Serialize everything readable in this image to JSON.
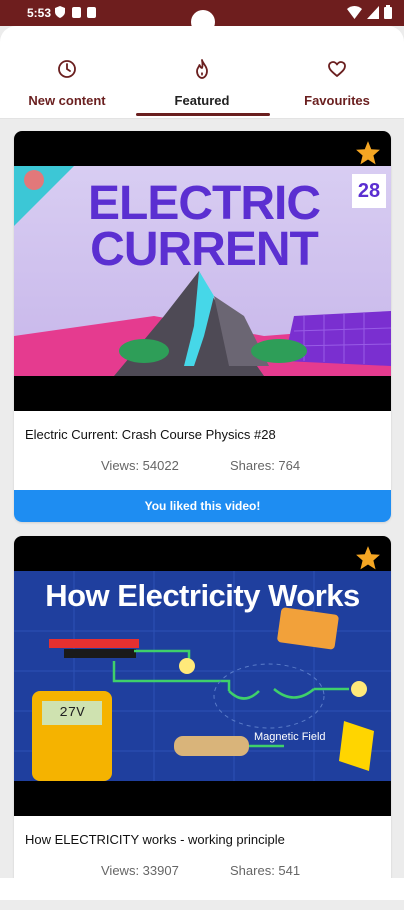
{
  "status_bar": {
    "time": "5:53"
  },
  "tabs": [
    {
      "label": "New content",
      "icon": "clock-icon"
    },
    {
      "label": "Featured",
      "icon": "fire-icon",
      "active": true
    },
    {
      "label": "Favourites",
      "icon": "heart-icon"
    }
  ],
  "videos": [
    {
      "thumbnail_text": "ELECTRIC CURRENT",
      "thumbnail_badge": "28",
      "title": "Electric Current: Crash Course Physics #28",
      "views_label": "Views: 54022",
      "shares_label": "Shares: 764",
      "liked_text": "You liked this video!"
    },
    {
      "thumbnail_text": "How Electricity Works",
      "thumbnail_meter": "27V",
      "thumbnail_caption": "Magnetic Field",
      "title": "How ELECTRICITY works - working principle",
      "views_label": "Views: 33907",
      "shares_label": "Shares: 541"
    }
  ],
  "colors": {
    "accent": "#6a1f1f",
    "liked": "#1e8df2",
    "star": "#f5a623"
  }
}
